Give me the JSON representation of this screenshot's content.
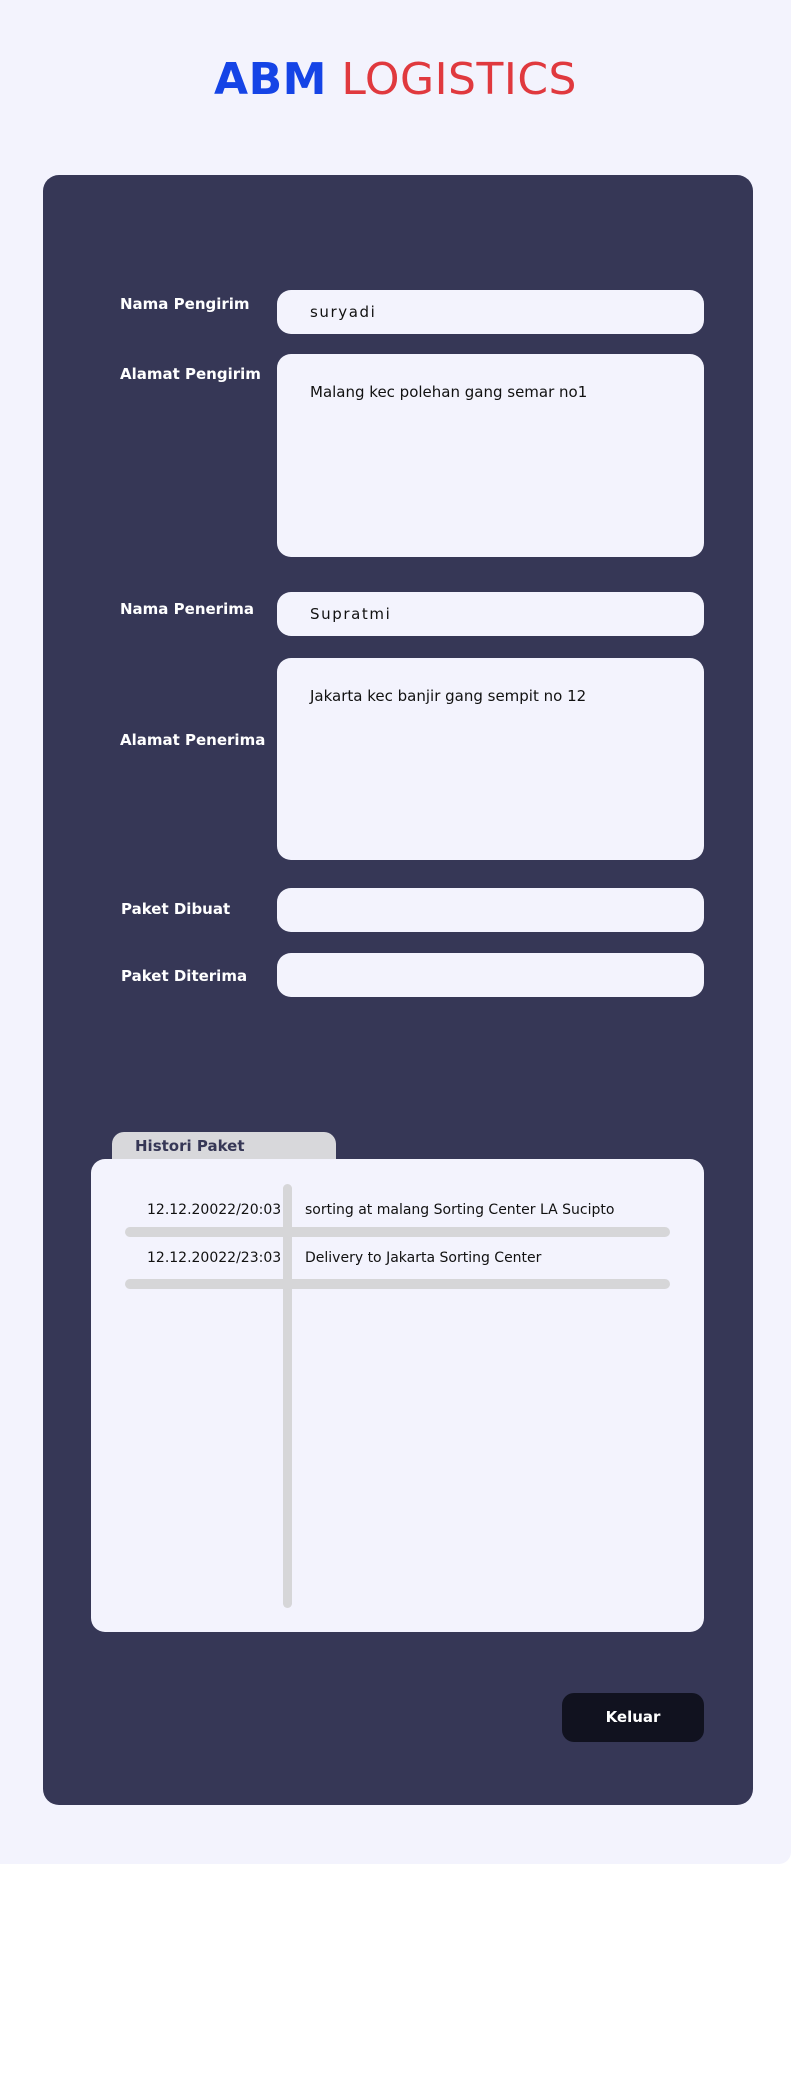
{
  "brand": {
    "name_bold": "ABM",
    "name_light": "LOGISTICS",
    "color_bold": "#1544e6",
    "color_light": "#e0393e"
  },
  "form": {
    "sender_name": {
      "label": "Nama Pengirim",
      "value": "suryadi"
    },
    "sender_address": {
      "label": "Alamat Pengirim",
      "value": "Malang kec polehan gang semar no1"
    },
    "recipient_name": {
      "label": "Nama Penerima",
      "value": "Supratmi"
    },
    "recipient_address": {
      "label": "Alamat Penerima",
      "value": "Jakarta kec banjir gang sempit no 12"
    },
    "package_created": {
      "label": "Paket Dibuat",
      "value": ""
    },
    "package_received": {
      "label": "Paket Diterima",
      "value": ""
    }
  },
  "history": {
    "tab_label": "Histori Paket",
    "rows": [
      {
        "timestamp": "12.12.20022/20:03",
        "description": "sorting at malang Sorting Center LA Sucipto"
      },
      {
        "timestamp": "12.12.20022/23:03",
        "description": "Delivery to Jakarta Sorting Center"
      }
    ]
  },
  "actions": {
    "exit_label": "Keluar"
  },
  "colors": {
    "page_bg": "#f3f3fd",
    "card_bg": "#363756",
    "button_bg": "#11121f",
    "divider": "#d6d6d8"
  }
}
